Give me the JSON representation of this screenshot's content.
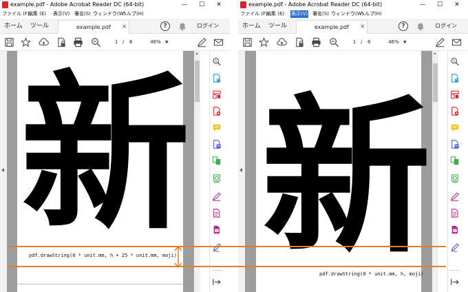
{
  "windows": [
    {
      "title": "example.pdf - Adobe Acrobat Reader DC (64-bit)",
      "menu": [
        "ファイル (F)",
        "編集 (E)",
        "表示(V)",
        "署名(S)",
        "ウィンドウ(W)",
        "ヘルプ(H)"
      ],
      "active_menu_index": -1,
      "tabs": {
        "home": "ホーム",
        "tools": "ツール",
        "document": "example.pdf"
      },
      "login": "ログイン",
      "page_current": "1",
      "page_separator": "/",
      "page_total": "6",
      "zoom": "46%",
      "kanji": "新",
      "code_text": "pdf.drawString(0 * unit.mm, h + 25 * unit.mm, moji)"
    },
    {
      "title": "example.pdf - Adobe Acrobat Reader DC (64-bit)",
      "menu": [
        "ファイル (F)",
        "編集 (E)",
        "表示(V)",
        "署名(S)",
        "ウィンドウ(W)",
        "ヘルプ(H)"
      ],
      "active_menu_index": 2,
      "tabs": {
        "home": "ホーム",
        "tools": "ツール",
        "document": "example.pdf"
      },
      "login": "ログイン",
      "page_current": "1",
      "page_separator": "/",
      "page_total": "6",
      "zoom": "46%",
      "kanji": "新",
      "code_text": "pdf.drawString(0 * unit.mm, h, moji)"
    }
  ],
  "window_controls": {
    "minimize": "—",
    "maximize": "☐",
    "close": "✕"
  },
  "tab_close_glyph": "×",
  "help_glyph": "?",
  "zoom_caret_glyph": "▼",
  "annotation_color": "#e67e22",
  "acrobat_red": "#d8262f",
  "menu_highlight": "#2b6fd6",
  "toolbar_icons": [
    "save-icon",
    "bookmark-star-icon",
    "cloud-upload-icon",
    "protect-file-icon",
    "print-icon",
    "zoom-out-search-icon"
  ],
  "right_tool_icons": [
    "search-zoom-icon",
    "export-pdf-icon",
    "organize-pages-icon",
    "create-pdf-icon",
    "comment-icon",
    "send-for-review-icon",
    "combine-files-icon",
    "stamp-icon",
    "fill-sign-icon",
    "edit-pdf-icon",
    "compress-pdf-icon",
    "sign-icon",
    "expand-panel-icon"
  ]
}
